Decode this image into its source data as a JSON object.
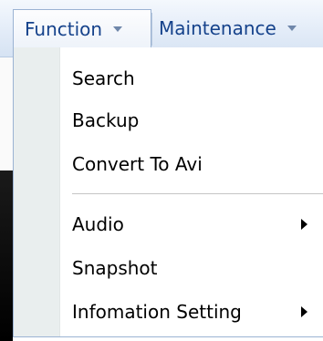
{
  "menubar": {
    "items": [
      {
        "label": "Function",
        "icon": "chevron-down-icon"
      },
      {
        "label": "Maintenance",
        "icon": "chevron-down-icon"
      }
    ]
  },
  "function_menu": {
    "items": [
      {
        "label": "Search"
      },
      {
        "label": "Backup"
      },
      {
        "label": "Convert To Avi"
      },
      {
        "label": "Audio",
        "icon": "chevron-right-icon"
      },
      {
        "label": "Snapshot"
      },
      {
        "label": "Infomation Setting",
        "icon": "chevron-right-icon"
      }
    ]
  }
}
